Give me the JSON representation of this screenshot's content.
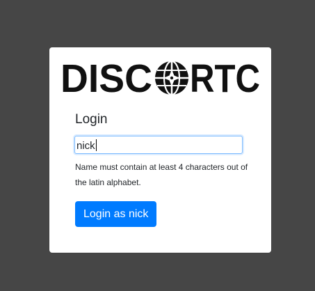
{
  "logo": {
    "text_left": "DISC",
    "text_right": "RTC"
  },
  "login": {
    "heading": "Login",
    "name_value": "nick",
    "help_text": "Name must contain at least 4 characters out of the latin alphabet.",
    "button_label": "Login as nick"
  },
  "colors": {
    "background": "#464646",
    "card": "#ffffff",
    "accent": "#007bff",
    "input_focus_border": "#80bdff"
  },
  "icons": {
    "logo_emblem": "globe-compass-icon"
  }
}
